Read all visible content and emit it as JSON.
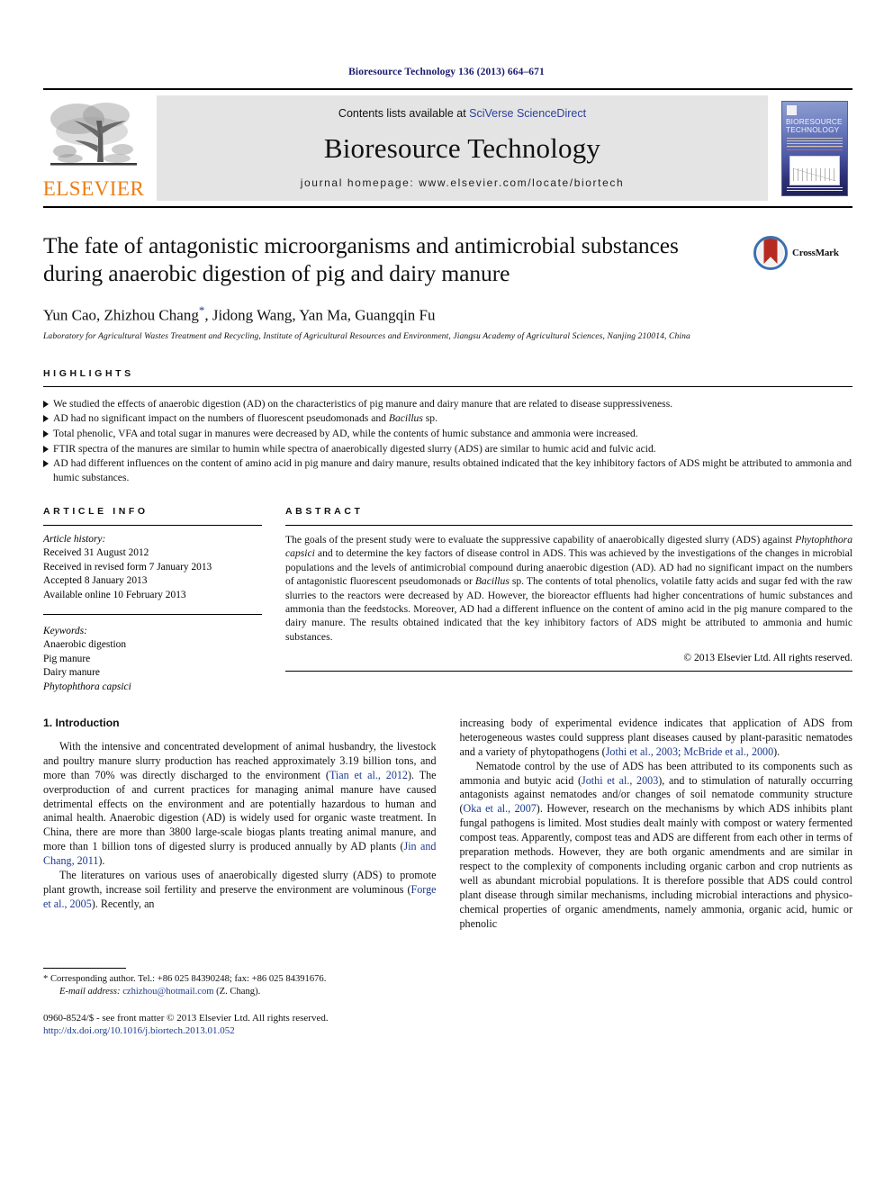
{
  "running_head": "Bioresource Technology 136 (2013) 664–671",
  "masthead": {
    "publisher_logo_label": "ELSEVIER",
    "contents_prefix": "Contents lists available at ",
    "contents_link": "SciVerse ScienceDirect",
    "journal_name": "Bioresource Technology",
    "homepage_line": "journal homepage: www.elsevier.com/locate/biortech",
    "cover_title_line1": "BIORESOURCE",
    "cover_title_line2": "TECHNOLOGY"
  },
  "article": {
    "title": "The fate of antagonistic microorganisms and antimicrobial substances during anaerobic digestion of pig and dairy manure",
    "authors_pre": "Yun Cao, Zhizhou Chang",
    "authors_star": "*",
    "authors_post": ", Jidong Wang, Yan Ma, Guangqin Fu",
    "affiliation": "Laboratory for Agricultural Wastes Treatment and Recycling, Institute of Agricultural Resources and Environment, Jiangsu Academy of Agricultural Sciences, Nanjing 210014, China",
    "crossmark_label": "CrossMark"
  },
  "highlights": {
    "heading": "HIGHLIGHTS",
    "items": [
      "We studied the effects of anaerobic digestion (AD) on the characteristics of pig manure and dairy manure that are related to disease suppressiveness.",
      "AD had no significant impact on the numbers of fluorescent pseudomonads and Bacillus sp.",
      "Total phenolic, VFA and total sugar in manures were decreased by AD, while the contents of humic substance and ammonia were increased.",
      "FTIR spectra of the manures are similar to humin while spectra of anaerobically digested slurry (ADS) are similar to humic acid and fulvic acid.",
      "AD had different influences on the content of amino acid in pig manure and dairy manure, results obtained indicated that the key inhibitory factors of ADS might be attributed to ammonia and humic substances."
    ]
  },
  "article_info": {
    "heading": "ARTICLE INFO",
    "history_label": "Article history:",
    "history": [
      "Received 31 August 2012",
      "Received in revised form 7 January 2013",
      "Accepted 8 January 2013",
      "Available online 10 February 2013"
    ],
    "keywords_label": "Keywords:",
    "keywords": [
      "Anaerobic digestion",
      "Pig manure",
      "Dairy manure",
      "Phytophthora capsici"
    ],
    "keywords_italic_index": 3
  },
  "abstract": {
    "heading": "ABSTRACT",
    "part1": "The goals of the present study were to evaluate the suppressive capability of anaerobically digested slurry (ADS) against ",
    "organism": "Phytophthora capsici",
    "part2": " and to determine the key factors of disease control in ADS. This was achieved by the investigations of the changes in microbial populations and the levels of antimicrobial compound during anaerobic digestion (AD). AD had no significant impact on the numbers of antagonistic fluorescent pseudomonads or ",
    "organism2": "Bacillus",
    "part3": " sp. The contents of total phenolics, volatile fatty acids and sugar fed with the raw slurries to the reactors were decreased by AD. However, the bioreactor effluents had higher concentrations of humic substances and ammonia than the feedstocks. Moreover, AD had a different influence on the content of amino acid in the pig manure compared to the dairy manure. The results obtained indicated that the key inhibitory factors of ADS might be attributed to ammonia and humic substances.",
    "copyright": "© 2013 Elsevier Ltd. All rights reserved."
  },
  "introduction": {
    "heading": "1. Introduction",
    "left_paragraphs": [
      {
        "segments": [
          {
            "t": "With the intensive and concentrated development of animal husbandry, the livestock and poultry manure slurry production has reached approximately 3.19 billion tons, and more than 70% was directly discharged to the environment ("
          },
          {
            "t": "Tian et al., 2012",
            "ref": true
          },
          {
            "t": "). The overproduction of and current practices for managing animal manure have caused detrimental effects on the environment and are potentially hazardous to human and animal health. Anaerobic digestion (AD) is widely used for organic waste treatment. In China, there are more than 3800 large-scale biogas plants treating animal manure, and more than 1 billion tons of digested slurry is produced annually by AD plants ("
          },
          {
            "t": "Jin and Chang, 2011",
            "ref": true
          },
          {
            "t": ")."
          }
        ]
      },
      {
        "segments": [
          {
            "t": "The literatures on various uses of anaerobically digested slurry (ADS) to promote plant growth, increase soil fertility and preserve the environment are voluminous ("
          },
          {
            "t": "Forge et al., 2005",
            "ref": true
          },
          {
            "t": "). Recently, an"
          }
        ]
      }
    ],
    "right_paragraphs": [
      {
        "indent": false,
        "segments": [
          {
            "t": "increasing body of experimental evidence indicates that application of ADS from heterogeneous wastes could suppress plant diseases caused by plant-parasitic nematodes and a variety of phytopathogens ("
          },
          {
            "t": "Jothi et al., 2003",
            "ref": true
          },
          {
            "t": "; "
          },
          {
            "t": "McBride et al., 2000",
            "ref": true
          },
          {
            "t": ")."
          }
        ]
      },
      {
        "indent": true,
        "segments": [
          {
            "t": "Nematode control by the use of ADS has been attributed to its components such as ammonia and butyic acid ("
          },
          {
            "t": "Jothi et al., 2003",
            "ref": true
          },
          {
            "t": "), and to stimulation of naturally occurring antagonists against nematodes and/or changes of soil nematode community structure ("
          },
          {
            "t": "Oka et al., 2007",
            "ref": true
          },
          {
            "t": "). However, research on the mechanisms by which ADS inhibits plant fungal pathogens is limited. Most studies dealt mainly with compost or watery fermented compost teas. Apparently, compost teas and ADS are different from each other in terms of preparation methods. However, they are both organic amendments and are similar in respect to the complexity of components including organic carbon and crop nutrients as well as abundant microbial populations. It is therefore possible that ADS could control plant disease through similar mechanisms, including microbial interactions and physico-chemical properties of organic amendments, namely ammonia, organic acid, humic or phenolic"
          }
        ]
      }
    ]
  },
  "footnote": {
    "corresponding": "* Corresponding author. Tel.: +86 025 84390248; fax: +86 025 84391676.",
    "email_label": "E-mail address:",
    "email": "czhizhou@hotmail.com",
    "email_suffix": " (Z. Chang)."
  },
  "imprint": {
    "line1": "0960-8524/$ - see front matter © 2013 Elsevier Ltd. All rights reserved.",
    "doi": "http://dx.doi.org/10.1016/j.biortech.2013.01.052"
  }
}
